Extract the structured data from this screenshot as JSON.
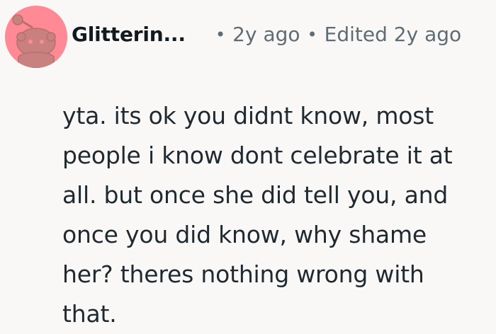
{
  "comment": {
    "author": {
      "username": "Glitterin...",
      "avatar_icon": "snoo-avatar-icon",
      "avatar_color": "#ff8a95"
    },
    "meta": {
      "separator": "•",
      "posted": "2y ago",
      "edited": "Edited 2y ago"
    },
    "body": "yta. its ok you didnt know, most people i know dont celebrate it at all. but once she did tell you, and once you did know, why shame her? theres nothing wrong with that."
  },
  "colors": {
    "background": "#faf8f7",
    "text": "#1f2a30",
    "meta_text": "#5f6c73",
    "avatar_bg": "#ff8a95",
    "avatar_mascot": "#c8817f"
  }
}
